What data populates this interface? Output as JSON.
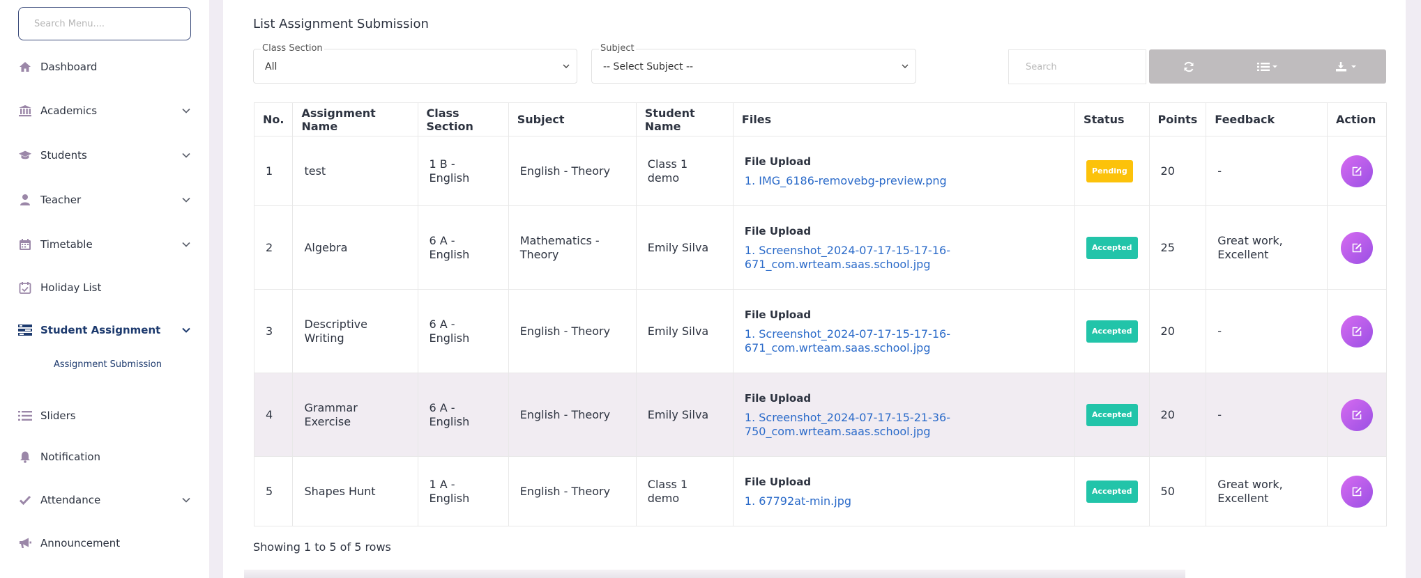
{
  "sidebar": {
    "search_placeholder": "Search Menu....",
    "items": [
      {
        "label": "Dashboard",
        "icon": "home-icon"
      },
      {
        "label": "Academics",
        "icon": "bank-icon"
      },
      {
        "label": "Students",
        "icon": "graduation-cap-icon"
      },
      {
        "label": "Teacher",
        "icon": "user-icon"
      },
      {
        "label": "Timetable",
        "icon": "calendar-icon"
      },
      {
        "label": "Holiday List",
        "icon": "calendar-check-icon"
      },
      {
        "label": "Student Assignment",
        "icon": "tasks-icon"
      },
      {
        "label": "Sliders",
        "icon": "list-icon"
      },
      {
        "label": "Notification",
        "icon": "bell-icon"
      },
      {
        "label": "Attendance",
        "icon": "check-icon"
      },
      {
        "label": "Announcement",
        "icon": "bullhorn-icon"
      }
    ],
    "sub_item": "Assignment Submission"
  },
  "page": {
    "title": "List Assignment Submission",
    "class_section": {
      "label": "Class Section",
      "value": "All"
    },
    "subject": {
      "label": "Subject",
      "value": "-- Select Subject --"
    },
    "search_placeholder": "Search",
    "footer": "Showing 1 to 5 of 5 rows"
  },
  "table": {
    "headers": [
      "No.",
      "Assignment Name",
      "Class Section",
      "Subject",
      "Student Name",
      "Files",
      "Status",
      "Points",
      "Feedback",
      "Action"
    ],
    "file_title": "File Upload",
    "rows": [
      {
        "no": "1",
        "name": "test",
        "section": "1 B - English",
        "subject": "English - Theory",
        "student": "Class 1 demo",
        "file": "1. IMG_6186-removebg-preview.png",
        "status": "Pending",
        "points": "20",
        "feedback": "-"
      },
      {
        "no": "2",
        "name": "Algebra",
        "section": "6 A - English",
        "subject": "Mathematics - Theory",
        "student": "Emily Silva",
        "file": "1. Screenshot_2024-07-17-15-17-16-671_com.wrteam.saas.school.jpg",
        "status": "Accepted",
        "points": "25",
        "feedback": "Great work, Excellent"
      },
      {
        "no": "3",
        "name": "Descriptive Writing",
        "section": "6 A - English",
        "subject": "English - Theory",
        "student": "Emily Silva",
        "file": "1. Screenshot_2024-07-17-15-17-16-671_com.wrteam.saas.school.jpg",
        "status": "Accepted",
        "points": "20",
        "feedback": "-"
      },
      {
        "no": "4",
        "name": "Grammar Exercise",
        "section": "6 A - English",
        "subject": "English - Theory",
        "student": "Emily Silva",
        "file": "1. Screenshot_2024-07-17-15-21-36-750_com.wrteam.saas.school.jpg",
        "status": "Accepted",
        "points": "20",
        "feedback": "-"
      },
      {
        "no": "5",
        "name": "Shapes Hunt",
        "section": "1 A - English",
        "subject": "English - Theory",
        "student": "Class 1 demo",
        "file": "1. 67792at-min.jpg",
        "status": "Accepted",
        "points": "50",
        "feedback": "Great work, Excellent"
      }
    ]
  },
  "colors": {
    "accent": "#1d3a6e",
    "link": "#2a6ac9",
    "pending": "#fcc20a",
    "accepted": "#22c4a9",
    "action": "#b95ee9"
  }
}
